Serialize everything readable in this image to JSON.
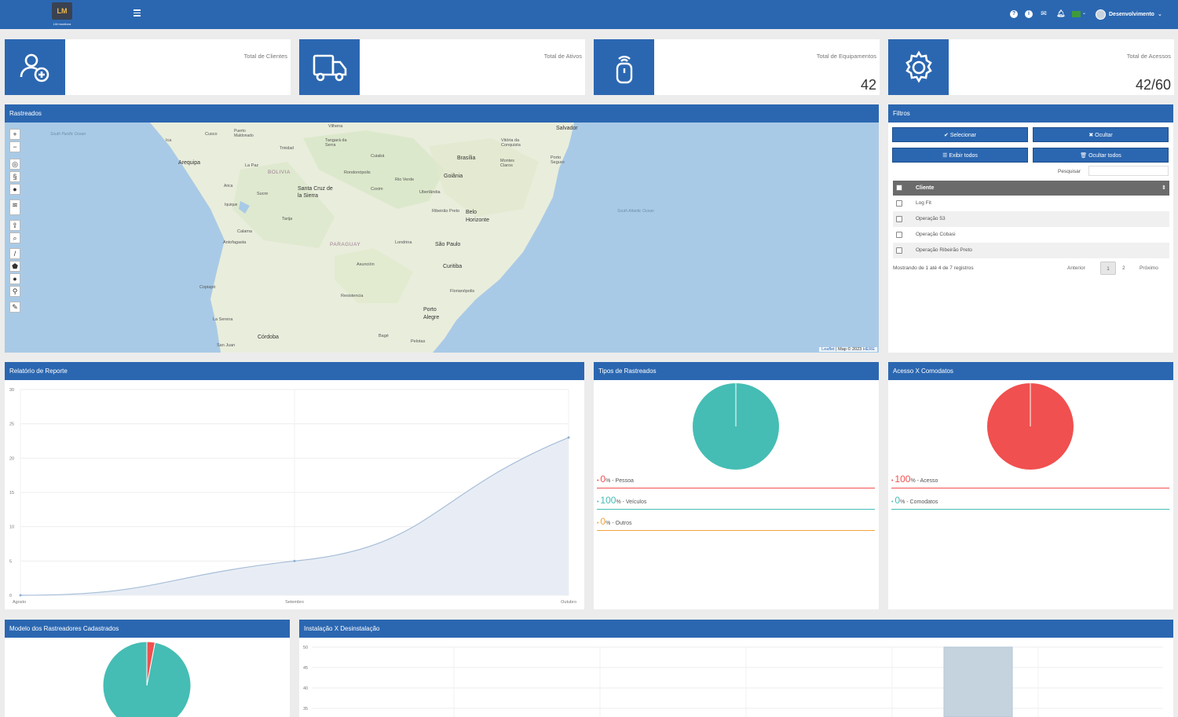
{
  "header": {
    "logo_text": "LM",
    "logo_sub": "LM monitora",
    "user_name": "Desenvolvimento",
    "icons": [
      "help-icon",
      "info-icon",
      "mail-icon",
      "bell-icon",
      "flag-icon"
    ]
  },
  "stats": [
    {
      "label": "Total de Clientes",
      "value": "",
      "icon": "add-user-icon"
    },
    {
      "label": "Total de Ativos",
      "value": "",
      "icon": "truck-icon"
    },
    {
      "label": "Total de Equipamentos",
      "value": "42",
      "icon": "tracker-device-icon"
    },
    {
      "label": "Total de Acessos",
      "value": "42/60",
      "icon": "gear-icon"
    }
  ],
  "map_panel": {
    "title": "Rastreados",
    "attribution_leaflet": "Leaflet",
    "attribution_rest": " | Map © 2023 ",
    "attribution_here": "HERE",
    "zoom_in": "+",
    "zoom_out": "−",
    "labels": {
      "salvador": "Salvador",
      "vitoria_conquista": "Vitória da Conquista",
      "porto_seguro": "Porto Seguro",
      "brasilia": "Brasília",
      "goiania": "Goiânia",
      "montes_claros": "Montes Claros",
      "uberlandia": "Uberlândia",
      "belo_horizonte": "Belo Horizonte",
      "ribeirao_preto": "Ribeirão Preto",
      "sao_paulo": "São Paulo",
      "londrina": "Londrina",
      "curitiba": "Curitiba",
      "florianopolis": "Florianópolis",
      "porto_alegre": "Porto Alegre",
      "pelotas": "Pelotas",
      "bage": "Bagé",
      "cuiaba": "Cuiabá",
      "rondonopolis": "Rondonópolis",
      "rio_verde": "Rio Verde",
      "vilhena": "Vilhena",
      "tangara": "Tangará da Serra",
      "santa_cruz": "Santa Cruz de la Sierra",
      "sucre": "Sucre",
      "la_paz": "La Paz",
      "arequipa": "Arequipa",
      "cusco": "Cusco",
      "puerto_maldonado": "Puerto Maldonado",
      "ica": "Ica",
      "trinidad": "Trinidad",
      "tarija": "Tarija",
      "calama": "Calama",
      "antofagasta": "Antofagasta",
      "copiapo": "Copiapó",
      "la_serena": "La Serena",
      "cordoba": "Córdoba",
      "san_juan": "San Juan",
      "resistencia": "Resistencia",
      "asuncion": "Asunción",
      "paraguay": "PARAGUAY",
      "bolivia": "BOLIVIA",
      "south_atlantic": "South Atlantic Ocean",
      "south_pacific": "South Pacific Ocean",
      "iquique": "Iquique",
      "coxim": "Coxim",
      "arica": "Arica"
    }
  },
  "filters": {
    "title": "Filtros",
    "btn_select": "✔ Selecionar",
    "btn_hide": "✖ Ocultar",
    "btn_show_all": "☰ Exibir todos",
    "btn_hide_all": "🗑 Ocultar todos",
    "search_label": "Pesquisar",
    "column": "Cliente",
    "rows": [
      "Log Fit",
      "Operação 53",
      "Operação Cobasi",
      "Operação Ribeirão Preto"
    ],
    "showing": "Mostrando de 1 até 4 de 7 registros",
    "prev": "Anterior",
    "page1": "1",
    "page2": "2",
    "next": "Próximo"
  },
  "report_panel": {
    "title": "Relatório de Reporte"
  },
  "types_panel": {
    "title": "Tipos de Rastreados",
    "legend": [
      {
        "pct": "0",
        "suffix": "% - Pessoa",
        "color": "#f0504f"
      },
      {
        "pct": "100",
        "suffix": "% - Veículos",
        "color": "#45bdb4"
      },
      {
        "pct": "0",
        "suffix": "% - Outros",
        "color": "#f2a33c"
      }
    ]
  },
  "access_panel": {
    "title": "Acesso X Comodatos",
    "legend": [
      {
        "pct": "100",
        "suffix": "% - Acesso",
        "color": "#f0504f"
      },
      {
        "pct": "0",
        "suffix": "% - Comodatos",
        "color": "#45bdb4"
      }
    ]
  },
  "models_panel": {
    "title": "Modelo dos Rastreadores Cadastrados"
  },
  "install_panel": {
    "title": "Instalação X Desinstalação"
  },
  "chart_data": [
    {
      "type": "area",
      "categories": [
        "Agosto",
        "Setembro",
        "Outubro"
      ],
      "values": [
        0,
        5,
        23
      ],
      "ylim": [
        0,
        30
      ],
      "yticks": [
        0,
        5,
        10,
        15,
        20,
        25,
        30
      ],
      "color": "#a8bed8",
      "grid": true
    },
    {
      "type": "pie",
      "values": [
        0,
        100,
        0
      ],
      "colors": [
        "#f0504f",
        "#45bdb4",
        "#f2a33c"
      ]
    },
    {
      "type": "pie",
      "values": [
        100,
        0
      ],
      "colors": [
        "#f0504f",
        "#45bdb4"
      ]
    },
    {
      "type": "pie",
      "values": [
        3,
        97
      ],
      "colors": [
        "#f0504f",
        "#45bdb4"
      ]
    },
    {
      "type": "bar",
      "ylim": [
        0,
        50
      ],
      "yticks": [
        35,
        40,
        45,
        50
      ],
      "values": [
        50
      ],
      "color": "#c5d3df",
      "grid": true
    }
  ]
}
